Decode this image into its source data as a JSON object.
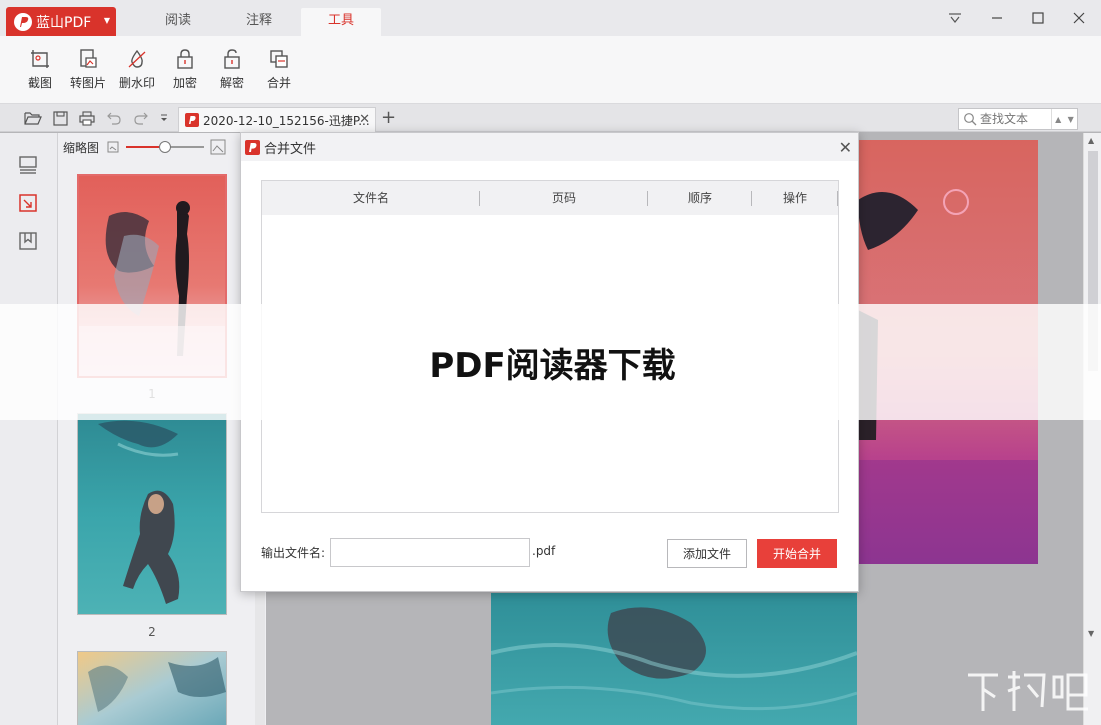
{
  "app": {
    "name": "蓝山PDF"
  },
  "menu": {
    "tabs": [
      "阅读",
      "注释",
      "工具"
    ],
    "active": "工具"
  },
  "ribbon": {
    "tools": [
      "截图",
      "转图片",
      "删水印",
      "加密",
      "解密",
      "合并"
    ]
  },
  "document": {
    "tab_title": "2020-12-10_152156-迅捷P...",
    "search_placeholder": "查找文本"
  },
  "thumbnails": {
    "label": "缩略图",
    "zoom_fraction": 0.5,
    "pages": [
      "1",
      "2"
    ]
  },
  "dialog": {
    "title": "合并文件",
    "columns": [
      "文件名",
      "页码",
      "顺序",
      "操作"
    ],
    "output_label": "输出文件名:",
    "output_value": "",
    "extension": ".pdf",
    "add_button": "添加文件",
    "merge_button": "开始合并"
  },
  "watermark": {
    "text": "PDF阅读器下载"
  },
  "colors": {
    "brand": "#d9332b",
    "merge_button": "#e8403a"
  },
  "icons": [
    "logo-icon",
    "menu-icon",
    "minimize-icon",
    "maximize-icon",
    "close-icon",
    "open-icon",
    "save-icon",
    "print-icon",
    "undo-icon",
    "redo-icon",
    "search-icon",
    "thumbnail-icon",
    "bookmark-icon",
    "outline-icon"
  ]
}
